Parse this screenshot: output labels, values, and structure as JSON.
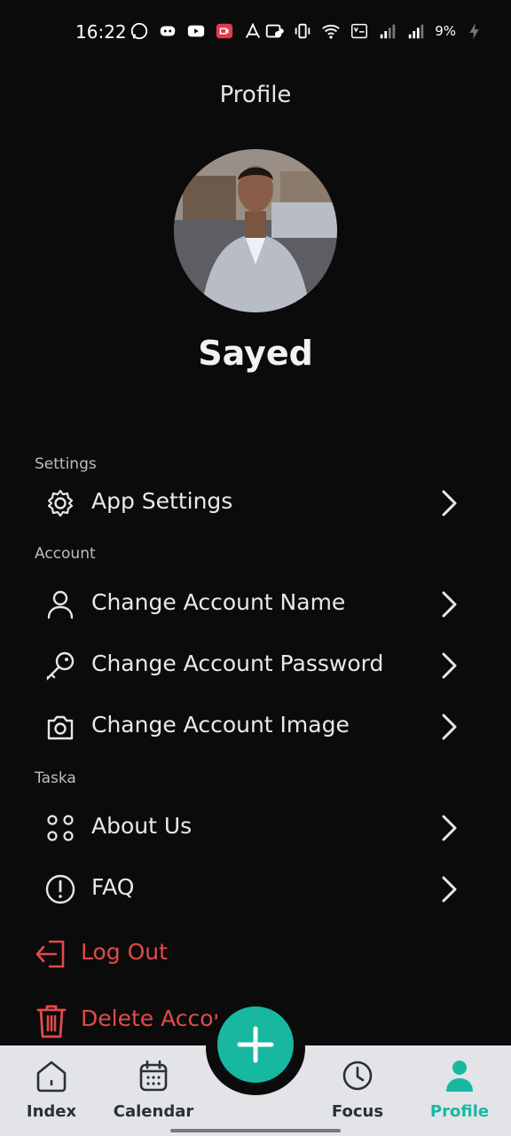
{
  "status_bar": {
    "time": "16:22",
    "battery": "9%"
  },
  "page_title": "Profile",
  "user": {
    "name": "Sayed"
  },
  "sections": {
    "settings": {
      "label": "Settings",
      "items": [
        {
          "label": "App Settings",
          "icon": "gear-icon"
        }
      ]
    },
    "account": {
      "label": "Account",
      "items": [
        {
          "label": "Change Account Name",
          "icon": "user-icon"
        },
        {
          "label": "Change Account Password",
          "icon": "key-icon"
        },
        {
          "label": "Change Account Image",
          "icon": "camera-icon"
        }
      ]
    },
    "taska": {
      "label": "Taska",
      "items": [
        {
          "label": "About Us",
          "icon": "dots-grid-icon"
        },
        {
          "label": "FAQ",
          "icon": "info-circle-icon"
        }
      ]
    }
  },
  "actions": {
    "logout": {
      "label": "Log Out",
      "icon": "logout-icon"
    },
    "delete": {
      "label": "Delete Account",
      "icon": "trash-icon"
    }
  },
  "nav": {
    "items": [
      {
        "label": "Index",
        "icon": "home-icon"
      },
      {
        "label": "Calendar",
        "icon": "calendar-icon"
      },
      {
        "label": "Focus",
        "icon": "clock-icon"
      },
      {
        "label": "Profile",
        "icon": "profile-icon"
      }
    ],
    "fab_icon": "plus-icon"
  },
  "colors": {
    "accent": "#18b8a0",
    "danger": "#e24a4a",
    "background": "#0b0b0c",
    "nav_background": "#e2e4e8"
  }
}
